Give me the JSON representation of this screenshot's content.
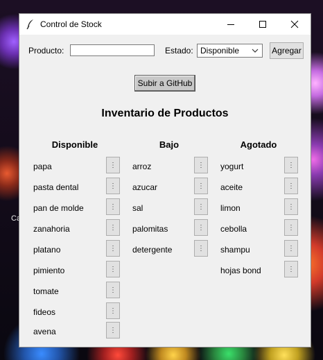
{
  "window": {
    "title": "Control de Stock"
  },
  "form": {
    "product_label": "Producto:",
    "product_value": "",
    "state_label": "Estado:",
    "state_selected": "Disponible",
    "add_button": "Agregar",
    "github_button": "Subir a GitHub"
  },
  "inventory": {
    "title": "Inventario de Productos",
    "columns": [
      {
        "heading": "Disponible",
        "items": [
          "papa",
          "pasta dental",
          "pan de molde",
          "zanahoria",
          "platano",
          "pimiento",
          "tomate",
          "fideos",
          "avena"
        ]
      },
      {
        "heading": "Bajo",
        "items": [
          "arroz",
          "azucar",
          "sal",
          "palomitas",
          "detergente"
        ]
      },
      {
        "heading": "Agotado",
        "items": [
          "yogurt",
          "aceite",
          "limon",
          "cebolla",
          "shampu",
          "hojas bond"
        ]
      }
    ],
    "item_button_glyph": "⋮"
  },
  "desktop": {
    "partial_text": "Ca"
  },
  "icons": {
    "app": "feather-icon",
    "minimize": "minimize-icon",
    "maximize": "maximize-icon",
    "close": "close-icon",
    "dropdown": "chevron-down-icon"
  }
}
